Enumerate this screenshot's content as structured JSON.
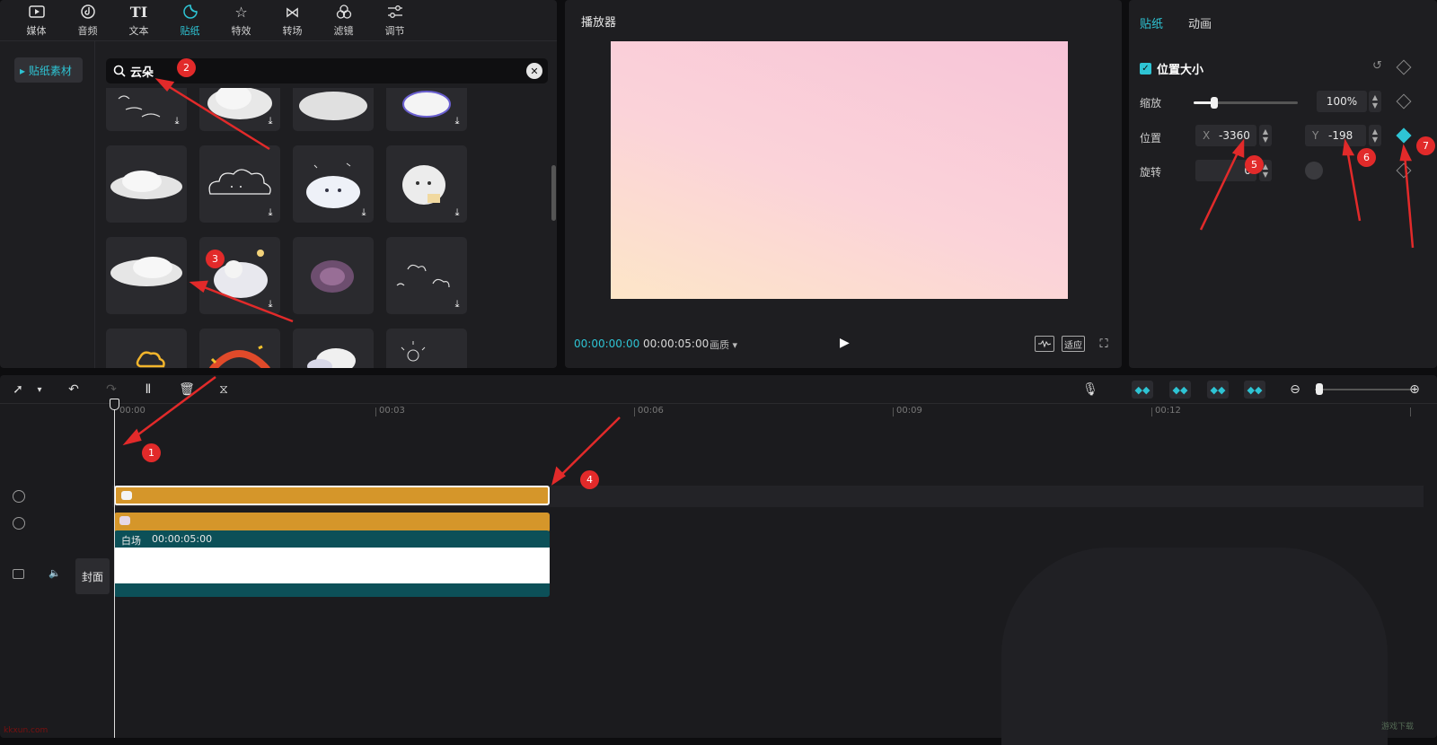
{
  "toolbar": {
    "tabs": [
      {
        "label": "媒体",
        "icon": "media-icon"
      },
      {
        "label": "音频",
        "icon": "audio-icon"
      },
      {
        "label": "文本",
        "icon": "text-icon"
      },
      {
        "label": "贴纸",
        "icon": "sticker-icon",
        "active": true
      },
      {
        "label": "特效",
        "icon": "effects-icon"
      },
      {
        "label": "转场",
        "icon": "transition-icon"
      },
      {
        "label": "滤镜",
        "icon": "filter-icon"
      },
      {
        "label": "调节",
        "icon": "adjust-icon"
      }
    ]
  },
  "sidebar": {
    "active_item": "▸ 贴纸素材"
  },
  "search": {
    "query": "云朵",
    "clear_glyph": "✕"
  },
  "stickers": {
    "download_glyph": "⤓"
  },
  "player": {
    "title": "播放器",
    "current_time": "00:00:00:00",
    "total_time": "00:00:05:00",
    "quality": "画质 ▾",
    "ratio_label": "适应"
  },
  "properties": {
    "tabs": [
      "贴纸",
      "动画"
    ],
    "section": "位置大小",
    "scale_label": "缩放",
    "scale_value": "100%",
    "scale_level": 0.2,
    "position_label": "位置",
    "x_axis": "X",
    "x_value": "-3360",
    "y_axis": "Y",
    "y_value": "-198",
    "rotation_label": "旋转",
    "rotation_value": "0"
  },
  "timeline": {
    "ticks": [
      "00:00",
      "00:03",
      "00:06",
      "00:09",
      "00:12"
    ],
    "video_clip_label": "白场",
    "video_clip_duration": "00:00:05:00",
    "cover_label": "封面"
  },
  "annotations": [
    "1",
    "2",
    "3",
    "4",
    "5",
    "6",
    "7"
  ],
  "watermark": "kkxun.com",
  "watermark_right": "游戏下载",
  "colors": {
    "accent": "#2ec4d4",
    "sticker_clip": "#d5962a",
    "video_clip": "#0c5058",
    "annotation": "#e22a2a"
  }
}
